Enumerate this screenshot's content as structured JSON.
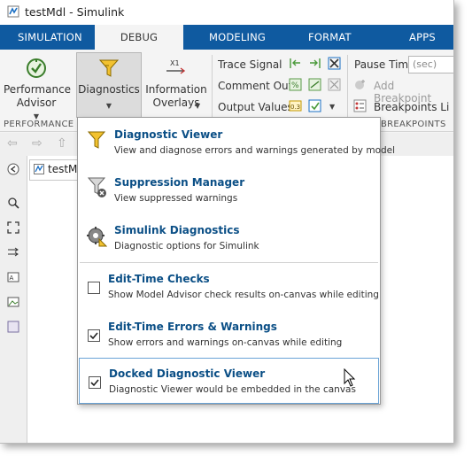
{
  "window": {
    "title": "testMdl - Simulink"
  },
  "tabs": [
    {
      "label": "SIMULATION"
    },
    {
      "label": "DEBUG"
    },
    {
      "label": "MODELING"
    },
    {
      "label": "FORMAT"
    },
    {
      "label": "APPS"
    }
  ],
  "ribbon": {
    "performance_advisor": {
      "line1": "Performance",
      "line2": "Advisor"
    },
    "diagnostics": {
      "label": "Diagnostics"
    },
    "information_overlays": {
      "line1": "Information",
      "line2": "Overlays",
      "icon_text": "X1"
    },
    "trace_signal": "Trace Signal",
    "comment_out": "Comment Out",
    "output_values": "Output Values",
    "pause_time_label": "Pause Time",
    "pause_time_placeholder": "(sec)",
    "add_breakpoint": "Add Breakpoint",
    "breakpoints_list": "Breakpoints Li",
    "section_performance": "PERFORMANCE",
    "section_breakpoints": "BREAKPOINTS"
  },
  "breadcrumb": {
    "model": "testMdl"
  },
  "menu": {
    "items": [
      {
        "title": "Diagnostic Viewer",
        "desc": "View and diagnose errors and warnings generated by model"
      },
      {
        "title": "Suppression Manager",
        "desc": "View suppressed warnings"
      },
      {
        "title": "Simulink Diagnostics",
        "desc": "Diagnostic options for Simulink"
      },
      {
        "title": "Edit-Time Checks",
        "desc": "Show Model Advisor check results on-canvas while editing",
        "checked": false
      },
      {
        "title": "Edit-Time Errors & Warnings",
        "desc": "Show errors and warnings on-canvas while editing",
        "checked": true
      },
      {
        "title": "Docked Diagnostic Viewer",
        "desc": "Diagnostic Viewer would be embedded in the canvas",
        "checked": true
      }
    ]
  },
  "colors": {
    "tab_bar": "#0f5aa0",
    "menu_title": "#0b4f86",
    "hover_border": "#6aa3d6"
  }
}
